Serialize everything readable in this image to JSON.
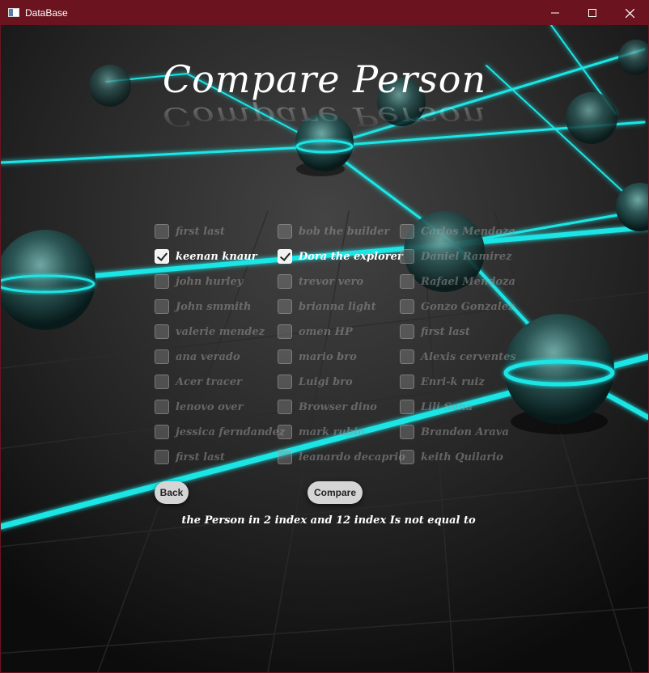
{
  "window": {
    "title": "DataBase",
    "controls": [
      "minimize-icon",
      "maximize-icon",
      "close-icon"
    ]
  },
  "heading": "Compare Person",
  "columns": [
    [
      {
        "label": "first last",
        "checked": false
      },
      {
        "label": "keenan knaur",
        "checked": true
      },
      {
        "label": "john hurley",
        "checked": false
      },
      {
        "label": "John smmith",
        "checked": false
      },
      {
        "label": "valerie mendez",
        "checked": false
      },
      {
        "label": "ana verado",
        "checked": false
      },
      {
        "label": "Acer tracer",
        "checked": false
      },
      {
        "label": "lenovo over",
        "checked": false
      },
      {
        "label": "jessica ferndandez",
        "checked": false
      },
      {
        "label": "first last",
        "checked": false
      }
    ],
    [
      {
        "label": "bob the builder",
        "checked": false
      },
      {
        "label": "Dora the explorer",
        "checked": true
      },
      {
        "label": "trevor vero",
        "checked": false
      },
      {
        "label": "brianna light",
        "checked": false
      },
      {
        "label": "omen HP",
        "checked": false
      },
      {
        "label": "mario bro",
        "checked": false
      },
      {
        "label": "Luigi bro",
        "checked": false
      },
      {
        "label": "Browser dino",
        "checked": false
      },
      {
        "label": "mark rubio",
        "checked": false
      },
      {
        "label": "leanardo decaprio",
        "checked": false
      }
    ],
    [
      {
        "label": "Carlos Mendoza",
        "checked": false
      },
      {
        "label": "Daniel Ramirez",
        "checked": false
      },
      {
        "label": "Rafael Mendoza",
        "checked": false
      },
      {
        "label": "Gonzo Gonzalez",
        "checked": false
      },
      {
        "label": "first last",
        "checked": false
      },
      {
        "label": "Alexis cerventes",
        "checked": false
      },
      {
        "label": "Enri-k ruiz",
        "checked": false
      },
      {
        "label": "Lili Sana",
        "checked": false
      },
      {
        "label": "Brandon Arava",
        "checked": false
      },
      {
        "label": "keith Quilario",
        "checked": false
      }
    ]
  ],
  "buttons": {
    "back": "Back",
    "compare": "Compare"
  },
  "result_text": "the Person in 2 index and 12 index Is not equal to",
  "colors": {
    "titlebar": "#6b1420",
    "accent": "#1fe5e6",
    "background": "#161616"
  }
}
